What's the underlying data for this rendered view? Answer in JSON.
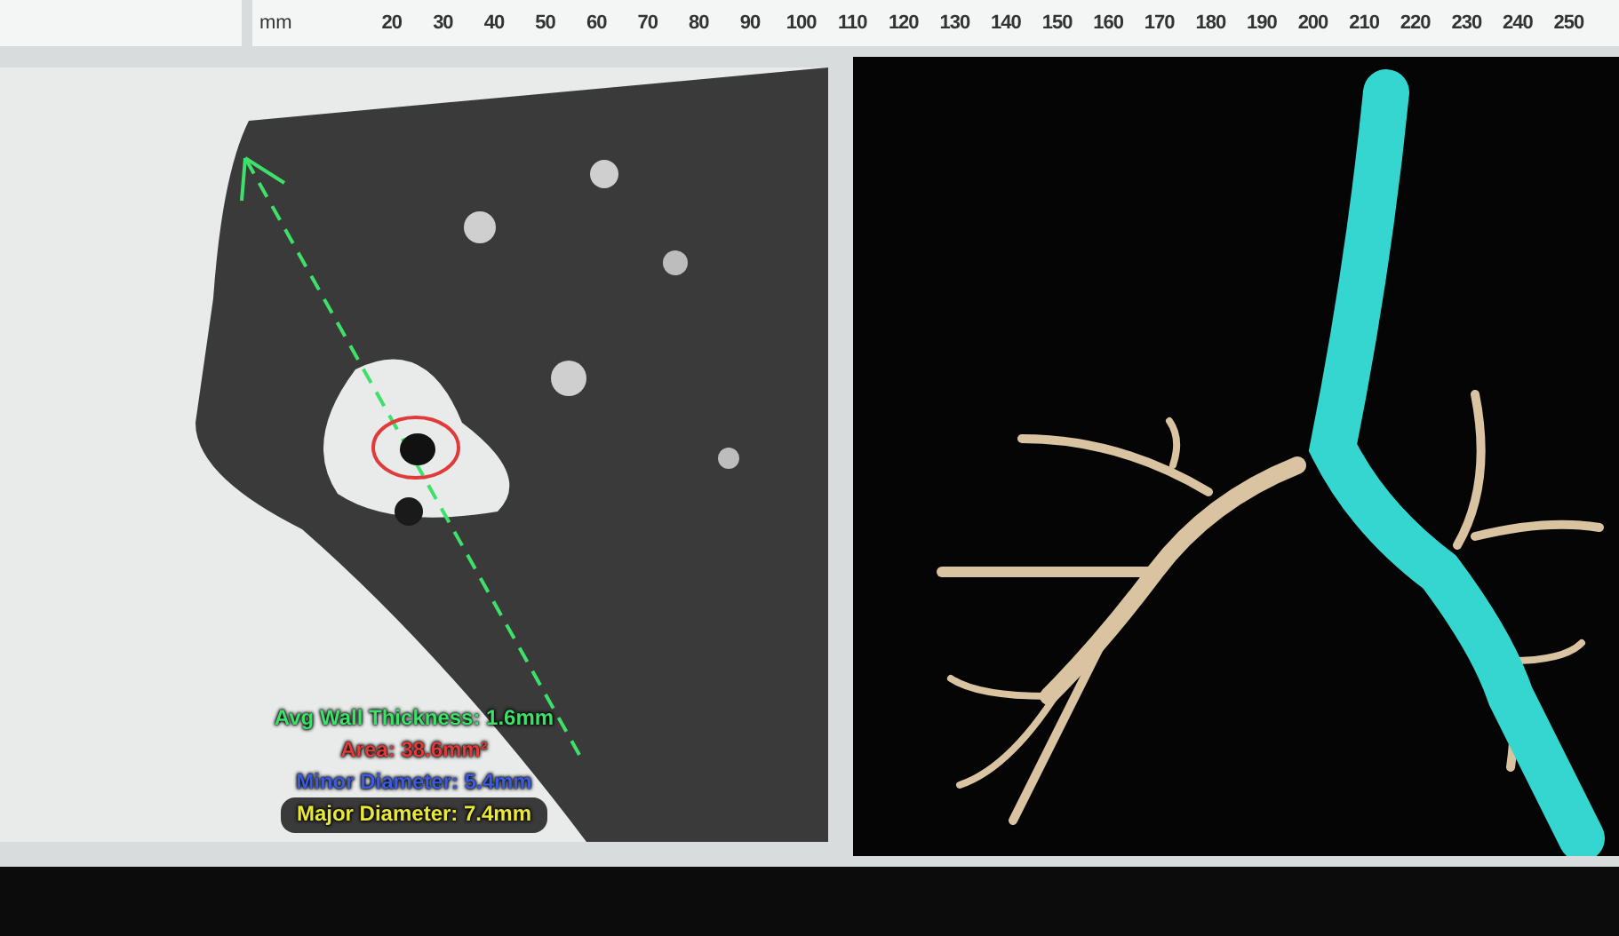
{
  "ruler": {
    "unit": "mm",
    "labels": [
      "20",
      "30",
      "40",
      "50",
      "60",
      "70",
      "80",
      "90",
      "100",
      "110",
      "120",
      "130",
      "140",
      "150",
      "160",
      "170",
      "180",
      "190",
      "200",
      "210",
      "220",
      "230",
      "240",
      "250"
    ]
  },
  "ct_panel": {
    "measurements": [
      {
        "text": "Avg Wall Thickness: 1.6mm",
        "color": "#3ee06a"
      },
      {
        "text": "Area: 38.6mm²",
        "color": "#e03a3a"
      },
      {
        "text": "Minor Diameter: 5.4mm",
        "color": "#3a5ae0"
      },
      {
        "text": "Major Diameter: 7.4mm",
        "color": "#e8e83a"
      }
    ]
  }
}
